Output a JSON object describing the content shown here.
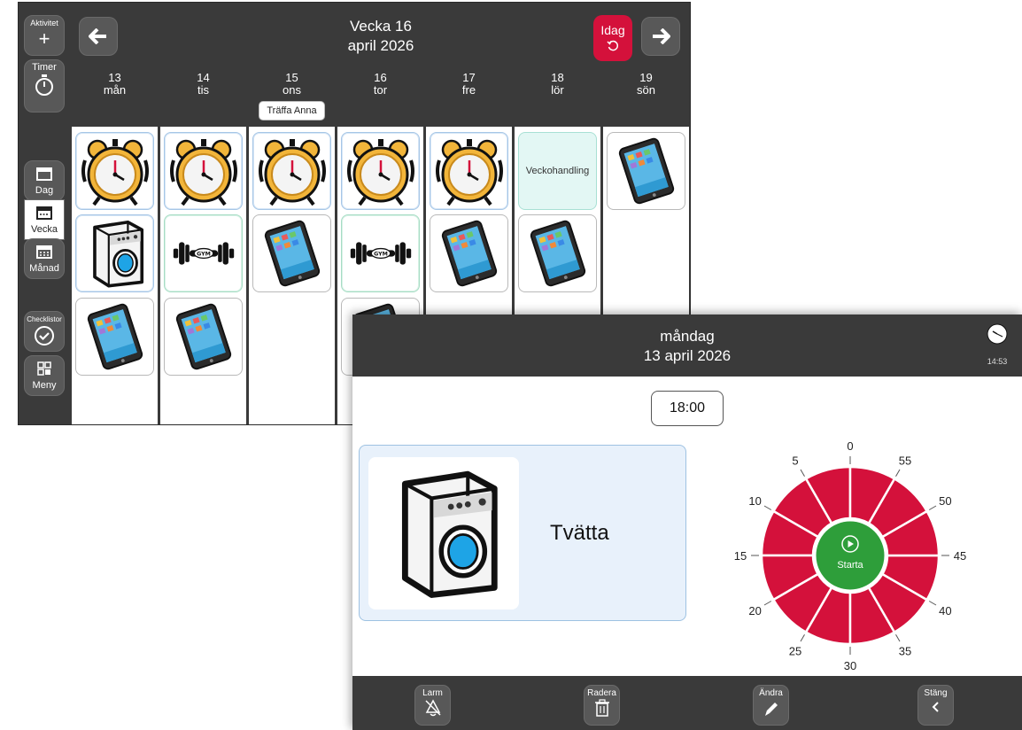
{
  "week_view": {
    "title": "Vecka 16",
    "subtitle": "april 2026",
    "today_label": "Idag",
    "sidebar": {
      "aktivitet": "Aktivitet",
      "timer": "Timer",
      "dag": "Dag",
      "vecka": "Vecka",
      "manad": "Månad",
      "checklistor": "Checklistor",
      "meny": "Meny"
    },
    "days": [
      {
        "num": "13",
        "name": "mån",
        "event": ""
      },
      {
        "num": "14",
        "name": "tis",
        "event": ""
      },
      {
        "num": "15",
        "name": "ons",
        "event": "Träffa Anna"
      },
      {
        "num": "16",
        "name": "tor",
        "event": ""
      },
      {
        "num": "17",
        "name": "fre",
        "event": ""
      },
      {
        "num": "18",
        "name": "lör",
        "event": ""
      },
      {
        "num": "19",
        "name": "sön",
        "event": ""
      }
    ],
    "text_tile": "Veckohandling"
  },
  "day_view": {
    "weekday": "måndag",
    "date": "13 april 2026",
    "clock_time": "14:53",
    "time": "18:00",
    "activity": "Tvätta",
    "timer": {
      "start_label": "Starta",
      "tick_labels": [
        "0",
        "5",
        "10",
        "15",
        "20",
        "25",
        "30",
        "35",
        "40",
        "45",
        "50",
        "55"
      ],
      "remaining_fraction": 1.0
    },
    "toolbar": {
      "larm": "Larm",
      "radera": "Radera",
      "andra": "Ändra",
      "stang": "Stäng"
    }
  },
  "colors": {
    "bar": "#3a3a3a",
    "accent_red": "#d4113b",
    "start_green": "#2e9e3a",
    "card_blue": "#e8f1fb"
  }
}
